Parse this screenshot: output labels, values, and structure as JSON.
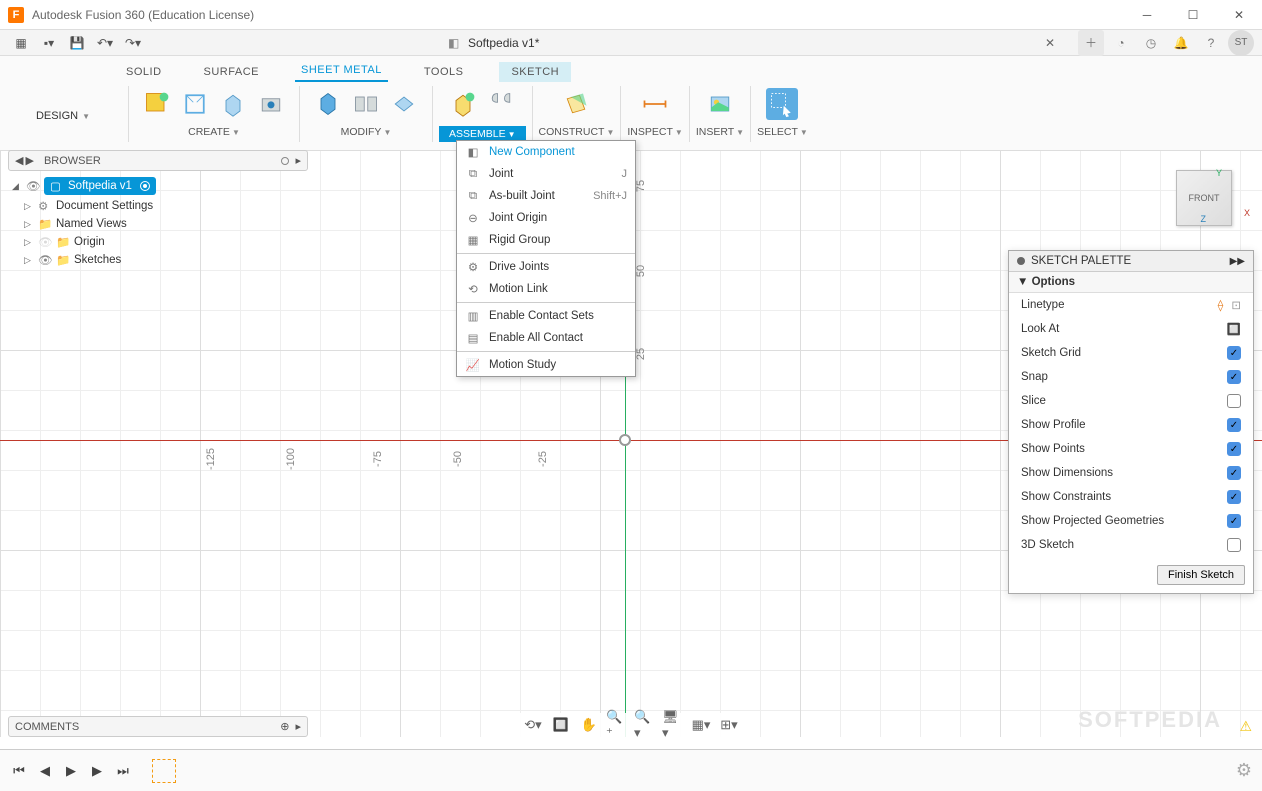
{
  "titlebar": {
    "app_title": "Autodesk Fusion 360 (Education License)",
    "logo_letter": "F"
  },
  "document": {
    "name": "Softpedia v1*"
  },
  "ribbon_tabs": {
    "solid": "SOLID",
    "surface": "SURFACE",
    "sheetmetal": "SHEET METAL",
    "tools": "TOOLS",
    "sketch": "SKETCH"
  },
  "workspace": {
    "label": "DESIGN"
  },
  "ribgroups": {
    "create": "CREATE",
    "modify": "MODIFY",
    "assemble": "ASSEMBLE",
    "construct": "CONSTRUCT",
    "inspect": "INSPECT",
    "insert": "INSERT",
    "select": "SELECT"
  },
  "assemble_menu": {
    "new_component": "New Component",
    "joint": "Joint",
    "joint_sc": "J",
    "asbuilt": "As-built Joint",
    "asbuilt_sc": "Shift+J",
    "joint_origin": "Joint Origin",
    "rigid_group": "Rigid Group",
    "drive_joints": "Drive Joints",
    "motion_link": "Motion Link",
    "enable_contact_sets": "Enable Contact Sets",
    "enable_all_contact": "Enable All Contact",
    "motion_study": "Motion Study"
  },
  "browser": {
    "title": "BROWSER",
    "root": "Softpedia v1",
    "items": [
      "Document Settings",
      "Named Views",
      "Origin",
      "Sketches"
    ]
  },
  "palette": {
    "title": "SKETCH PALETTE",
    "section": "Options",
    "rows": [
      {
        "label": "Linetype",
        "type": "icons"
      },
      {
        "label": "Look At",
        "type": "icon"
      },
      {
        "label": "Sketch Grid",
        "type": "check",
        "on": true
      },
      {
        "label": "Snap",
        "type": "check",
        "on": true
      },
      {
        "label": "Slice",
        "type": "check",
        "on": false
      },
      {
        "label": "Show Profile",
        "type": "check",
        "on": true
      },
      {
        "label": "Show Points",
        "type": "check",
        "on": true
      },
      {
        "label": "Show Dimensions",
        "type": "check",
        "on": true
      },
      {
        "label": "Show Constraints",
        "type": "check",
        "on": true
      },
      {
        "label": "Show Projected Geometries",
        "type": "check",
        "on": true
      },
      {
        "label": "3D Sketch",
        "type": "check",
        "on": false
      }
    ],
    "finish": "Finish Sketch"
  },
  "viewcube": {
    "face": "FRONT",
    "y": "Y",
    "x": "X",
    "z": "Z"
  },
  "comments": {
    "title": "COMMENTS"
  },
  "ticks": [
    "-125",
    "-100",
    "-75",
    "-50",
    "-25",
    "25",
    "50",
    "75"
  ],
  "avatar": "ST",
  "watermark": "SOFTPEDIA"
}
